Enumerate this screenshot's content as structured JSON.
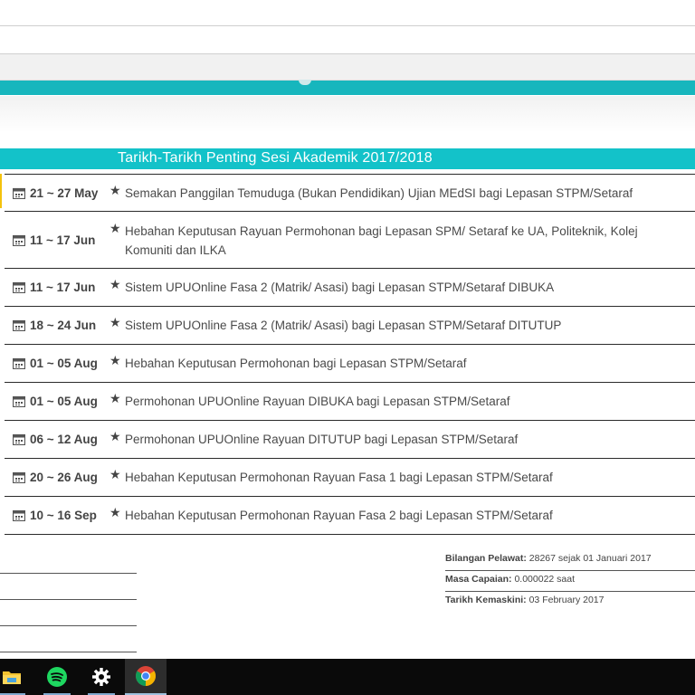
{
  "table": {
    "title": "Tarikh-Tarikh Penting Sesi Akademik 2017/2018",
    "rows": [
      {
        "date": "21 ~ 27 May",
        "event": "Semakan Panggilan Temuduga (Bukan Pendidikan) Ujian MEdSI bagi Lepasan STPM/Setaraf"
      },
      {
        "date": "11 ~ 17 Jun",
        "event": "Hebahan Keputusan Rayuan Permohonan bagi Lepasan SPM/ Setaraf ke UA, Politeknik, Kolej Komuniti dan ILKA"
      },
      {
        "date": "11 ~ 17 Jun",
        "event": "Sistem UPUOnline Fasa 2 (Matrik/ Asasi) bagi Lepasan STPM/Setaraf DIBUKA"
      },
      {
        "date": "18 ~ 24 Jun",
        "event": "Sistem UPUOnline Fasa 2 (Matrik/ Asasi) bagi Lepasan STPM/Setaraf DITUTUP"
      },
      {
        "date": "01 ~ 05 Aug",
        "event": "Hebahan Keputusan Permohonan bagi Lepasan STPM/Setaraf"
      },
      {
        "date": "01 ~ 05 Aug",
        "event": "Permohonan UPUOnline Rayuan DIBUKA bagi Lepasan STPM/Setaraf"
      },
      {
        "date": "06 ~ 12 Aug",
        "event": "Permohonan UPUOnline Rayuan DITUTUP bagi Lepasan STPM/Setaraf"
      },
      {
        "date": "20 ~ 26 Aug",
        "event": "Hebahan Keputusan Permohonan Rayuan Fasa 1 bagi Lepasan STPM/Setaraf"
      },
      {
        "date": "10 ~ 16 Sep",
        "event": "Hebahan Keputusan Permohonan Rayuan Fasa 2 bagi Lepasan STPM/Setaraf"
      }
    ],
    "date_icon": "calendar-icon",
    "event_icon": "star-icon"
  },
  "stats": {
    "visitors_label": "Bilangan Pelawat:",
    "visitors_value": "28267 sejak 01 Januari 2017",
    "load_time_label": "Masa Capaian:",
    "load_time_value": "0.000022 saat",
    "updated_label": "Tarikh Kemaskini:",
    "updated_value": "03 February 2017"
  },
  "taskbar": {
    "items": [
      "file-explorer-icon",
      "spotify-icon",
      "settings-gear-icon",
      "chrome-icon"
    ],
    "active": "chrome-icon"
  },
  "colors": {
    "teal": "#13c2c9",
    "taskbar": "#0a0a0a"
  }
}
